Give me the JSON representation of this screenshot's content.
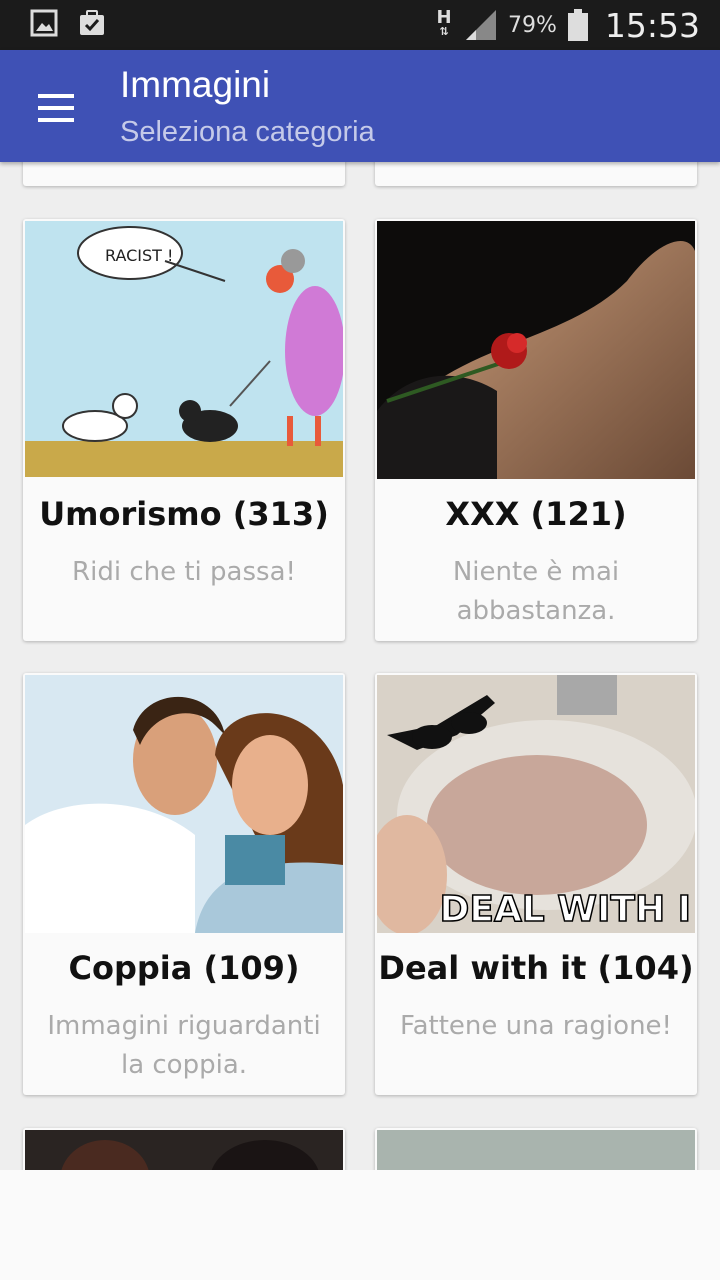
{
  "status_bar": {
    "network": "H",
    "battery_percent": "79%",
    "time": "15:53"
  },
  "app_bar": {
    "title": "Immagini",
    "subtitle": "Seleziona categoria"
  },
  "categories": [
    {
      "title": "Umorismo (313)",
      "description": "Ridi che ti passa!",
      "image": "cartoon-image"
    },
    {
      "title": "XXX (121)",
      "description": "Niente è mai abbastanza.",
      "image": "rose-photo"
    },
    {
      "title": "Coppia (109)",
      "description": "Immagini riguardanti la coppia.",
      "image": "couple-photo"
    },
    {
      "title": "Deal with it (104)",
      "description": "Fattene una ragione!",
      "image": "hedgehog-photo",
      "image_caption": "DEAL WITH I"
    }
  ],
  "colors": {
    "app_bar": "#3f51b5",
    "status_bar": "#1b1b1b",
    "background": "#eeeeee",
    "card": "#fafafa"
  }
}
